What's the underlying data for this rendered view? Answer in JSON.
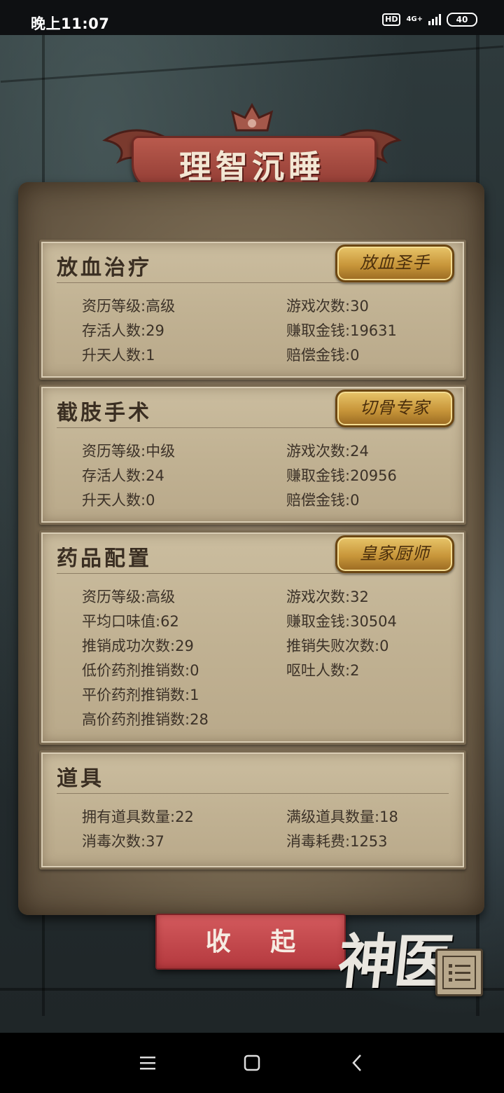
{
  "status_bar": {
    "time": "晚上11:07",
    "hd": "HD",
    "network": "4G+",
    "battery": "40"
  },
  "banner": {
    "title": "理智沉睡"
  },
  "sections": [
    {
      "title": "放血治疗",
      "badge": "放血圣手",
      "stats": [
        {
          "label": "资历等级",
          "value": "高级"
        },
        {
          "label": "游戏次数",
          "value": "30"
        },
        {
          "label": "存活人数",
          "value": "29"
        },
        {
          "label": "赚取金钱",
          "value": "19631"
        },
        {
          "label": "升天人数",
          "value": "1"
        },
        {
          "label": "赔偿金钱",
          "value": "0"
        }
      ]
    },
    {
      "title": "截肢手术",
      "badge": "切骨专家",
      "stats": [
        {
          "label": "资历等级",
          "value": "中级"
        },
        {
          "label": "游戏次数",
          "value": "24"
        },
        {
          "label": "存活人数",
          "value": "24"
        },
        {
          "label": "赚取金钱",
          "value": "20956"
        },
        {
          "label": "升天人数",
          "value": "0"
        },
        {
          "label": "赔偿金钱",
          "value": "0"
        }
      ]
    },
    {
      "title": "药品配置",
      "badge": "皇家厨师",
      "stats": [
        {
          "label": "资历等级",
          "value": "高级"
        },
        {
          "label": "游戏次数",
          "value": "32"
        },
        {
          "label": "平均口味值",
          "value": "62"
        },
        {
          "label": "赚取金钱",
          "value": "30504"
        },
        {
          "label": "推销成功次数",
          "value": "29"
        },
        {
          "label": "推销失败次数",
          "value": "0"
        },
        {
          "label": "低价药剂推销数",
          "value": "0"
        },
        {
          "label": "呕吐人数",
          "value": "2"
        },
        {
          "label": "平价药剂推销数",
          "value": "1"
        },
        {
          "label": "高价药剂推销数",
          "value": "28"
        }
      ]
    },
    {
      "title": "道具",
      "stats": [
        {
          "label": "拥有道具数量",
          "value": "22"
        },
        {
          "label": "满级道具数量",
          "value": "18"
        },
        {
          "label": "消毒次数",
          "value": "37"
        },
        {
          "label": "消毒耗费",
          "value": "1253"
        }
      ]
    }
  ],
  "collapse_button": "收 起",
  "logo_text": "神医",
  "icons": {
    "menu": "menu-list-icon",
    "nav_recent": "recent-apps-icon",
    "nav_home": "home-icon",
    "nav_back": "back-icon"
  }
}
